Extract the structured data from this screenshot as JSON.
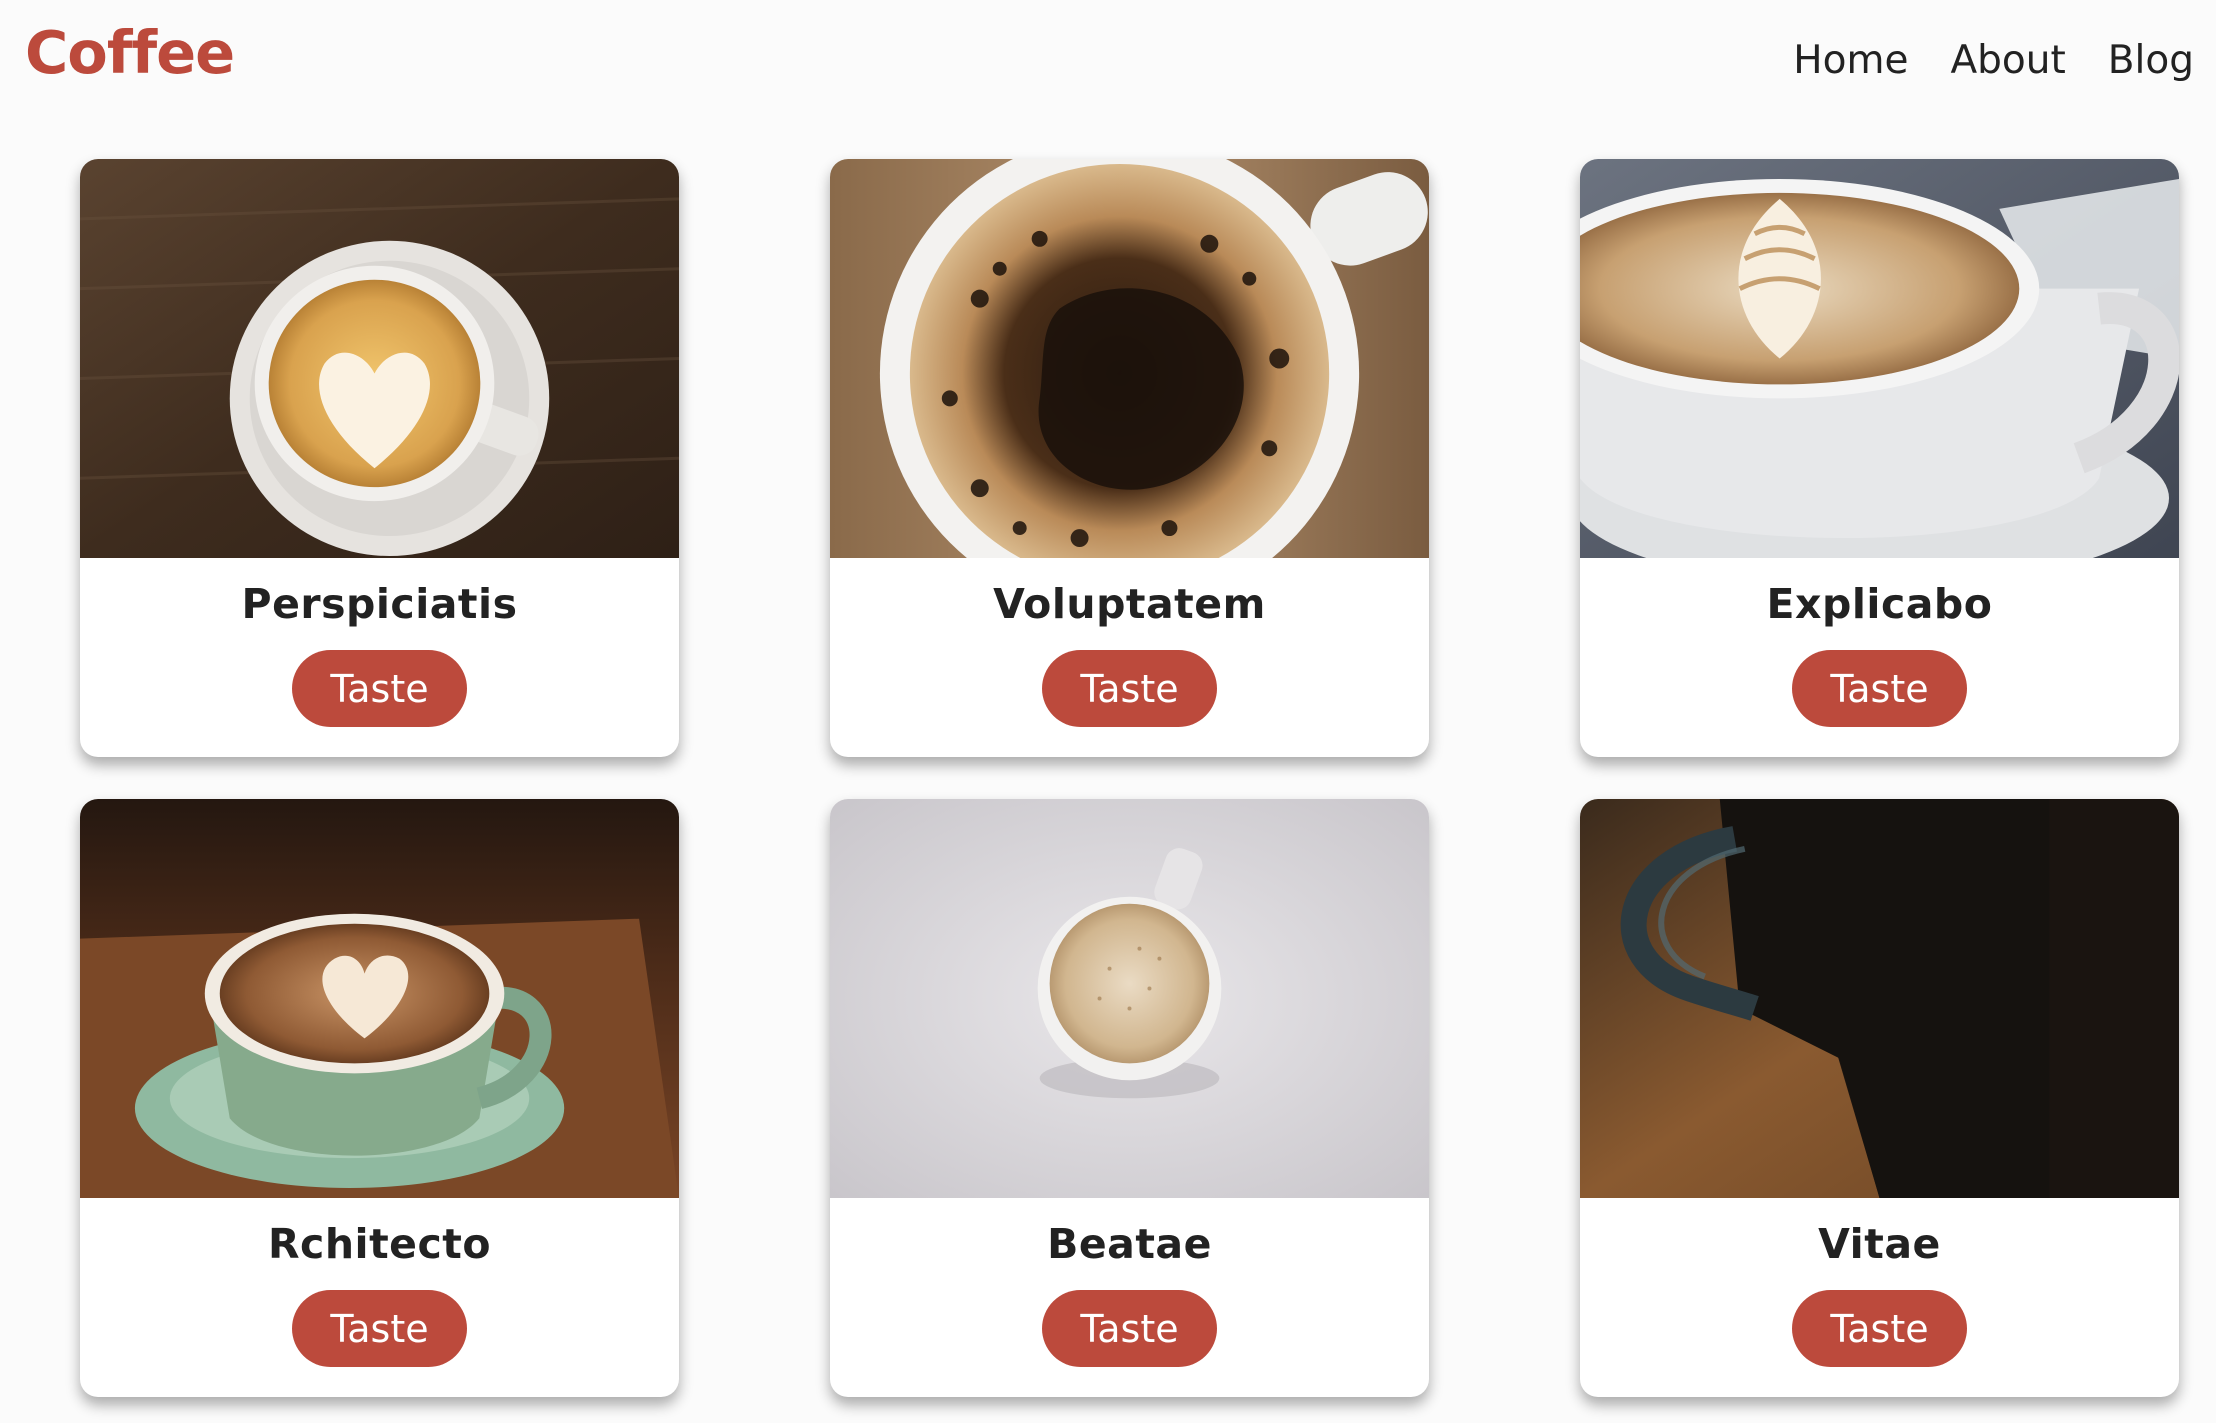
{
  "brand": {
    "logo": "Coffee",
    "accent": "#bc4a3c"
  },
  "nav": {
    "items": [
      {
        "label": "Home"
      },
      {
        "label": "About"
      },
      {
        "label": "Blog"
      }
    ]
  },
  "cards": [
    {
      "title": "Perspiciatis",
      "button": "Taste",
      "image": "latte-heart-art-on-dark-wood"
    },
    {
      "title": "Voluptatem",
      "button": "Taste",
      "image": "black-coffee-crema-top-view"
    },
    {
      "title": "Explicabo",
      "button": "Taste",
      "image": "latte-rosetta-white-cup"
    },
    {
      "title": "Rchitecto",
      "button": "Taste",
      "image": "latte-heart-green-cup"
    },
    {
      "title": "Beatae",
      "button": "Taste",
      "image": "small-cup-on-white-surface"
    },
    {
      "title": "Vitae",
      "button": "Taste",
      "image": "dark-mug-on-wood-table"
    }
  ]
}
